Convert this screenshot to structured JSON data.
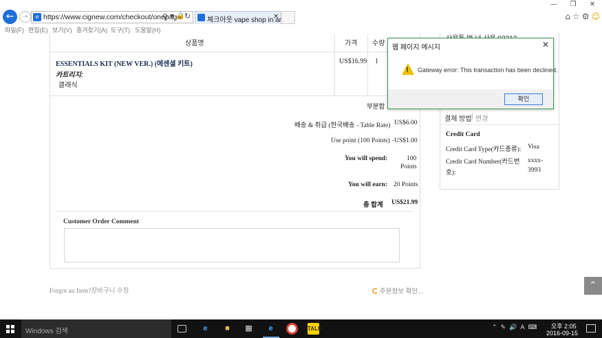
{
  "browser": {
    "url": "https://www.cignew.com/checkout/onepage/",
    "tab_title": "체크아웃 vape shop in arli...",
    "menu": [
      "파일(F)",
      "편집(E)",
      "보기(V)",
      "즐겨찾기(A)",
      "도구(T)",
      "도움말(H)"
    ]
  },
  "order": {
    "headers": {
      "product": "상품명",
      "price": "가격",
      "qty": "수량"
    },
    "item": {
      "name": "ESSENTIALS KIT (NEW VER.) (에센셜 키트)",
      "option_label": "카트리지:",
      "option_value": "클래식",
      "price": "US$16.99",
      "qty": "1"
    },
    "totals": {
      "subtotal_label": "부분합",
      "shipping_label": "배송 & 취급 (한국배송 - Table Rate)",
      "shipping_value": "US$6.00",
      "use_point_label": "Use point (100 Points)",
      "use_point_value": "-US$1.00",
      "will_spend_label": "You will spend:",
      "will_spend_value_1": "100",
      "will_spend_value_2": "Points",
      "will_earn_label": "You will earn:",
      "will_earn_value": "20 Points",
      "grand_total_label": "총 합계",
      "grand_total_value": "US$21.99"
    },
    "comment_title": "Customer Order Comment",
    "forgot_text": "Forgot an Item?",
    "forgot_link": "장바구니 수정",
    "loading_text": "주문정보 확인..."
  },
  "sidebar": {
    "top_text": "사용통 번 너 사용 03212",
    "payment_method_label": "결제 방법",
    "payment_separator": "|",
    "payment_edit": "변경",
    "payment_name": "Credit Card",
    "card_type_label": "Credit Card Type(카드종류):",
    "card_type_value": "Visa",
    "card_number_label_1": "Credit Card Number(카드번",
    "card_number_label_2": "호):",
    "card_number_value_1": "xxxx-",
    "card_number_value_2": "3993"
  },
  "dialog": {
    "title": "웹 페이지 메시지",
    "message": "Gateway error: This transaction has been declined.",
    "ok_label": "확인"
  },
  "taskbar": {
    "search_placeholder": "Windows 검색",
    "time": "오후 2:05",
    "date": "2016-09-15"
  }
}
